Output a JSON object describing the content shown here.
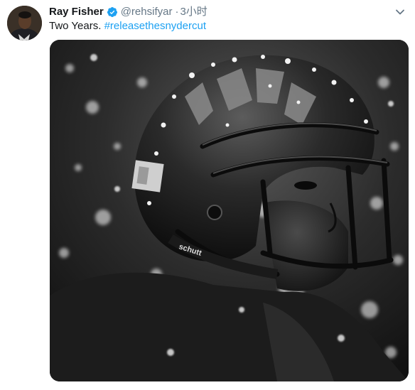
{
  "tweet": {
    "author": {
      "display_name": "Ray Fisher",
      "handle": "@rehsifyar",
      "verified": true
    },
    "separator": "·",
    "timestamp": "3小时",
    "text_plain": "Two Years.",
    "hashtag": "#releasethesnydercut",
    "media_alt_icon": "photo-football-player-helmet",
    "colors": {
      "hashtag": "#1da1f2",
      "verified_badge": "#1da1f2",
      "secondary_text": "#657786",
      "primary_text": "#14171a"
    }
  },
  "photo_text": {
    "helmet_brand": "schutt"
  }
}
